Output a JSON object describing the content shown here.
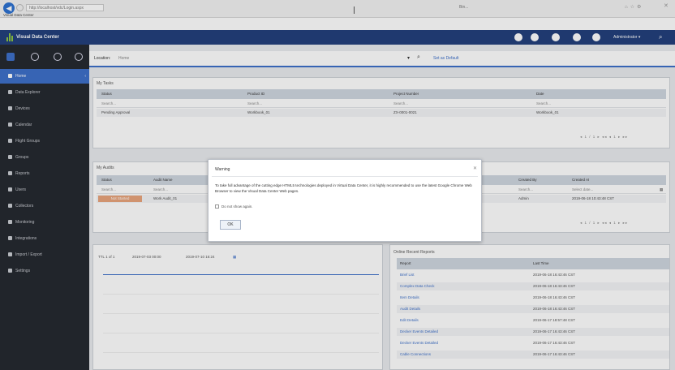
{
  "browser": {
    "address": "http://localhost/vdc/Login.aspx",
    "tab_label": "Visual Data Center",
    "search_text": "Bin...",
    "nav_back_icon": "back-arrow-icon"
  },
  "app": {
    "title": "Visual Data Center",
    "user_label": "Administrator ▾",
    "brand_color": "#1f3d7a",
    "accent_color": "#3b6ec9"
  },
  "sidebar": {
    "items": [
      {
        "label": "Home",
        "active": true
      },
      {
        "label": "Data Explorer"
      },
      {
        "label": "Devices"
      },
      {
        "label": "Calendar"
      },
      {
        "label": "Flight Groups"
      },
      {
        "label": "Groups"
      },
      {
        "label": "Reports"
      },
      {
        "label": "Users"
      },
      {
        "label": "Collectors"
      },
      {
        "label": "Monitoring"
      },
      {
        "label": "Integrations"
      },
      {
        "label": "Import / Export"
      },
      {
        "label": "Settings"
      }
    ]
  },
  "location": {
    "label": "Location:",
    "value": "Home",
    "search_icon": "search-icon",
    "link": "Set as Default"
  },
  "my_tasks": {
    "title": "My Tasks",
    "columns": [
      "Status",
      "Product ID",
      "Project Number",
      "Date"
    ],
    "filters": [
      "Search...",
      "Search...",
      "Search...",
      "Search..."
    ],
    "rows": [
      [
        "Pending Approval",
        "Workbook_01",
        "ZX-0001-0021",
        "Workbook_01"
      ]
    ],
    "pager": "◂ 1 / 1 ▸      ◂◂ ◂ 1 ▸ ▸▸"
  },
  "my_audits": {
    "title": "My Audits",
    "columns": [
      "Status",
      "Audit Name",
      "",
      "Created By",
      "Created At"
    ],
    "filters": [
      "Search...",
      "Search...",
      "",
      "Search...",
      "Select date..."
    ],
    "rows": [
      [
        "Not Started",
        "Work Audit_01",
        "",
        "Admin",
        "2019-06-18 10:43:48 CST"
      ]
    ],
    "pager": "◂ 1 / 1 ▸      ◂◂ ◂ 1 ▸ ▸▸"
  },
  "chart_toolbar": {
    "items": [
      "TTL 1 of 1",
      "2019-07-03 00:00",
      "2019-07-10 16:24"
    ]
  },
  "report_panel": {
    "title": "Online Recent Reports",
    "columns": [
      "Report",
      "Last Time"
    ],
    "rows": [
      [
        "Brief List",
        "2019-06-18 16:43:46 CST"
      ],
      [
        "Complex Data Check",
        "2019-06-18 16:43:46 CST"
      ],
      [
        "Item Details",
        "2019-06-18 16:43:46 CST"
      ],
      [
        "Audit Details",
        "2019-06-18 16:43:46 CST"
      ],
      [
        "Edit Details",
        "2019-06-17 18:57:48 CST"
      ],
      [
        "Decker Events Detailed",
        "2019-06-17 16:43:46 CST"
      ],
      [
        "Decker Events Detailed",
        "2019-06-17 16:43:46 CST"
      ],
      [
        "Cable Connections",
        "2019-06-17 16:43:46 CST"
      ]
    ]
  },
  "dialog": {
    "title": "Warning",
    "message": "To take full advantage of the cutting edge HTML5 technologies deployed in Virtual Data Center, it is highly recommended to use the latest Google Chrome Web Browser to view the Visual Data Center Web pages.",
    "checkbox_label": "Do not show again.",
    "ok_label": "OK",
    "close_icon": "close-icon"
  }
}
